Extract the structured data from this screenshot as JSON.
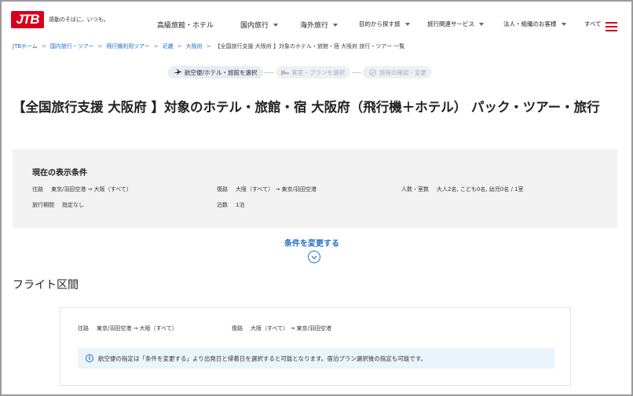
{
  "header": {
    "logo_text": "JTB",
    "tagline": "感動のそばに、いつも。",
    "nav": [
      {
        "label": "高級旅館・ホテル",
        "caret": false
      },
      {
        "label": "国内旅行",
        "caret": true
      },
      {
        "label": "海外旅行",
        "caret": true
      },
      {
        "label": "目的から探す旅",
        "caret": true
      },
      {
        "label": "旅行関連サービス",
        "caret": true
      },
      {
        "label": "法人・組織のお客様",
        "caret": true
      },
      {
        "label": "すべて",
        "caret": false
      }
    ]
  },
  "breadcrumb": {
    "items": [
      "JTBホーム",
      "国内旅行・ツアー",
      "飛行機利用ツアー",
      "近畿",
      "大阪府"
    ],
    "current": "【全国旅行支援 大阪府 】対象のホテル・旅館・宿 大阪府 旅行・ツアー 一覧"
  },
  "steps": [
    {
      "label": "航空便/ホテル・旅館を選択",
      "icon": "plane-building-icon",
      "active": true
    },
    {
      "label": "客室・プランを選択",
      "icon": "bed-icon",
      "active": false
    },
    {
      "label": "旅程の確認・変更",
      "icon": "check-circle-icon",
      "active": false
    }
  ],
  "page_title": "【全国旅行支援 大阪府 】対象のホテル・旅館・宿 大阪府（飛行機＋ホテル） パック・ツアー・旅行",
  "conditions": {
    "title": "現在の表示条件",
    "outbound": {
      "label": "往路",
      "value": "東京/羽田空港 → 大阪（すべて）"
    },
    "return": {
      "label": "復路",
      "value": "大阪（すべて） → 東京/羽田空港"
    },
    "people": {
      "label": "人数・室数",
      "value": "大人2名, こども0名, 幼児0名 / 1室"
    },
    "period": {
      "label": "旅行期間",
      "value": "指定なし"
    },
    "nights": {
      "label": "泊数",
      "value": "1泊"
    }
  },
  "change_link": "条件を変更する",
  "flight_section": {
    "title": "フライト区間",
    "outbound": {
      "label": "往路",
      "value": "東京/羽田空港 → 大阪（すべて）"
    },
    "return": {
      "label": "復路",
      "value": "大阪（すべて） → 東京/羽田空港"
    },
    "notice": "航空便の指定は「条件を変更する」より出発日と帰着日を選択すると可能となります。宿泊プラン選択後の指定も可能です。"
  },
  "colors": {
    "brand_red": "#d6001c",
    "link_blue": "#1f6ec7",
    "notice_bg": "#eaf4fb",
    "panel_bg": "#f2f2f2"
  }
}
